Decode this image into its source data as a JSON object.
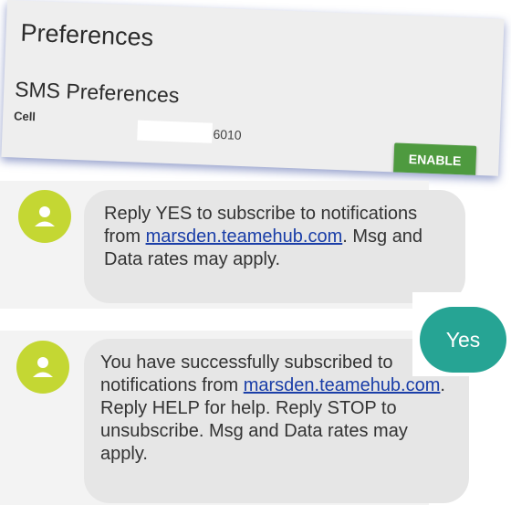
{
  "preferences": {
    "title": "Preferences",
    "sms_title": "SMS Preferences",
    "cell_label": "Cell",
    "cell_number_suffix": "6010",
    "enable_label": "ENABLE",
    "enable_color": "#4e9a3f"
  },
  "messages": [
    {
      "avatar_icon": "person-icon",
      "text_before": "Reply YES to subscribe to notifications from",
      "link": "marsden.teamehub.com",
      "text_after": ". Msg and Data rates may apply."
    },
    {
      "avatar_icon": "person-icon",
      "text_before": "You have successfully subscribed to notifications from",
      "link": "marsden.teamehub.com",
      "text_after": ". Reply HELP for help. Reply STOP to unsubscribe. Msg and Data rates may apply."
    }
  ],
  "reply": {
    "text": "Yes",
    "color": "#26a494"
  },
  "colors": {
    "avatar": "#c4d733",
    "bubble": "#e6e6e6",
    "link": "#1a3ea8"
  }
}
